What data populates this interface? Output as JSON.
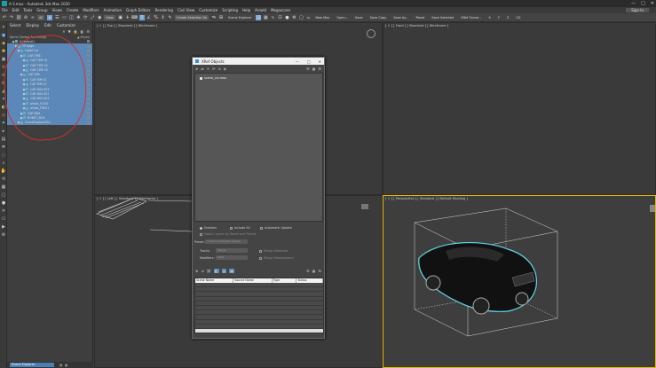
{
  "app": {
    "title": "A-3.max - Autodesk 3ds Max 2020",
    "window_controls": [
      "—",
      "□",
      "✕"
    ]
  },
  "menu": {
    "items": [
      "File",
      "Edit",
      "Tools",
      "Group",
      "Views",
      "Create",
      "Modifiers",
      "Animation",
      "Graph Editors",
      "Rendering",
      "Civil View",
      "Customize",
      "Scripting",
      "Help",
      "Arnold",
      "Megascans"
    ],
    "sign_in": "Sign In"
  },
  "toolbar": {
    "selection_filter": "All",
    "ref_coord": "View",
    "create_selection_set": "Create Selection Se",
    "scene_explorer_btn": "Scene Explorer",
    "right_buttons": [
      "New Max",
      "Open...",
      "Save",
      "Save Copy",
      "Save As...",
      "Reset",
      "Save Selected",
      "XRef Scene..."
    ],
    "axis": [
      "X",
      "Y",
      "Z"
    ],
    "cg_label": "CG"
  },
  "explorer": {
    "tabs": [
      "Select",
      "Display",
      "Edit",
      "Customize"
    ],
    "header_name": "Name (Sorted Ascending)",
    "header_frozen": "▲ Frozen",
    "rows": [
      {
        "label": "0 (default)",
        "indent": 1,
        "sel": false
      },
      {
        "label": "CP-edge",
        "indent": 2,
        "sel": true
      },
      {
        "label": "LowerCut",
        "indent": 3,
        "sel": true
      },
      {
        "label": "CAR TIRE",
        "indent": 4,
        "sel": true
      },
      {
        "label": "CAR TIRE 01",
        "indent": 5,
        "sel": true
      },
      {
        "label": "CAR TIRE 02",
        "indent": 5,
        "sel": true
      },
      {
        "label": "CAR TIRE 03",
        "indent": 5,
        "sel": true
      },
      {
        "label": "CAR RIM",
        "indent": 4,
        "sel": true
      },
      {
        "label": "CAR RIM 01",
        "indent": 5,
        "sel": true
      },
      {
        "label": "CAR RIM 02",
        "indent": 5,
        "sel": true
      },
      {
        "label": "CAR BOX 003",
        "indent": 5,
        "sel": true
      },
      {
        "label": "CAR BOX 002",
        "indent": 5,
        "sel": true
      },
      {
        "label": "CAR BOX 004",
        "indent": 5,
        "sel": true
      },
      {
        "label": "wheel_FL001",
        "indent": 5,
        "sel": true
      },
      {
        "label": "wheel_FR001",
        "indent": 5,
        "sel": true
      },
      {
        "label": "CAR BOX",
        "indent": 4,
        "sel": true
      },
      {
        "label": "ROBOT_BOX",
        "indent": 4,
        "sel": true
      },
      {
        "label": "SceneExplorer001",
        "indent": 3,
        "sel": true
      }
    ],
    "footer_label": "Scene Explorer"
  },
  "viewports": {
    "top": "[ + ] [ Top ] [ Standard ] [ Wireframe ]",
    "front": "[ + ] [ Front ] [ Standard ] [ Wireframe ]",
    "left": "[ + ] [ Left ] [ Standard ] [ Wireframe ]",
    "perspective": "[ + ] [ Perspective ] [ Standard ] [ Default Shading ]"
  },
  "xref": {
    "title": "XRef Objects",
    "file_item": "scene_car.max",
    "enabled": "Enabled",
    "include_all": "Include All",
    "automatic_update": "Automatic Update",
    "match_layers": "Match Layers by Name and Parent",
    "preset_label": "Preset:",
    "preset_value": "Custom Controller Preset",
    "tracks_label": "Tracks:",
    "tracks_value": "Merge",
    "modifiers_label": "Modifiers:",
    "modifiers_value": "XRef",
    "merge_materials": "Merge Materials",
    "merge_manipulators": "Merge Manipulators",
    "columns": [
      "Scene Name",
      "Source Name",
      "Type",
      "Status"
    ]
  }
}
